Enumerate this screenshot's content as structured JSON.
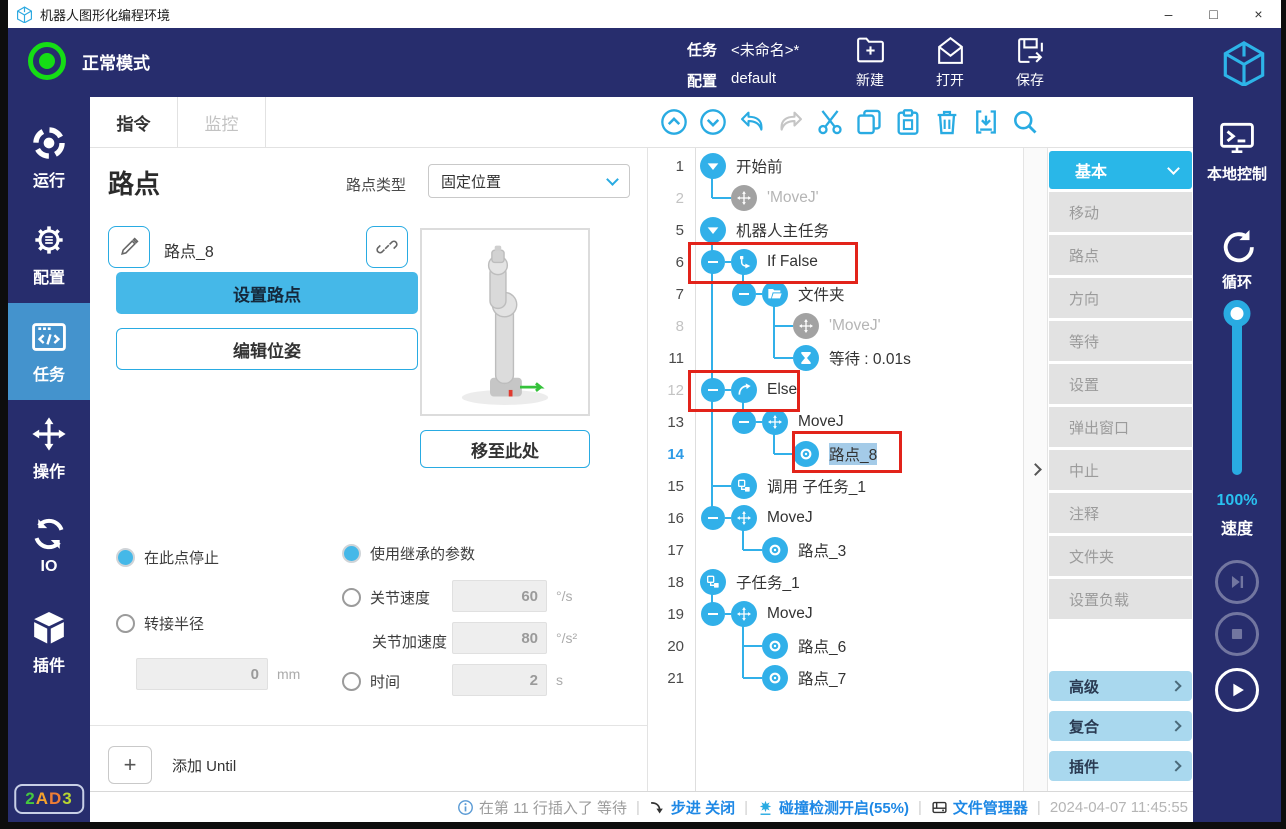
{
  "titlebar": {
    "title": "机器人图形化编程环境",
    "min": "–",
    "max": "□",
    "close": "×"
  },
  "header": {
    "mode_label": "正常模式",
    "task_label": "任务",
    "task_value": "<未命名>*",
    "config_label": "配置",
    "config_value": "default",
    "actions": [
      {
        "label": "新建"
      },
      {
        "label": "打开"
      },
      {
        "label": "保存"
      }
    ]
  },
  "left_nav": {
    "items": [
      {
        "label": "运行"
      },
      {
        "label": "配置"
      },
      {
        "label": "任务"
      },
      {
        "label": "操作"
      },
      {
        "label": "IO"
      },
      {
        "label": "插件"
      }
    ],
    "active_index": 2,
    "badge": {
      "chars": [
        {
          "ch": "2",
          "color": "#45c93f"
        },
        {
          "ch": "A",
          "color": "#f5a32c"
        },
        {
          "ch": "D",
          "color": "#ef7d35"
        },
        {
          "ch": "3",
          "color": "#b8d431"
        }
      ]
    }
  },
  "tabs": [
    {
      "label": "指令"
    },
    {
      "label": "监控"
    }
  ],
  "toolbar": {
    "icons": [
      "collapse-all",
      "expand-all",
      "undo",
      "redo",
      "cut",
      "copy",
      "paste",
      "delete",
      "insert",
      "search"
    ]
  },
  "waypoint": {
    "title": "路点",
    "type_label": "路点类型",
    "type_value": "固定位置",
    "name": "路点_8",
    "set_btn": "设置路点",
    "edit_btn": "编辑位姿",
    "move_btn": "移至此处",
    "stop_label": "在此点停止",
    "blend_label": "转接半径",
    "blend_value": "0",
    "blend_unit": "mm",
    "inherit_label": "使用继承的参数",
    "speed_label": "关节速度",
    "speed_value": "60",
    "speed_unit": "°/s",
    "accel_label": "关节加速度",
    "accel_value": "80",
    "accel_unit": "°/s²",
    "time_label": "时间",
    "time_value": "2",
    "time_unit": "s",
    "add_until": "添加 Until"
  },
  "tree": {
    "rows": [
      {
        "num": "1",
        "label": "开始前",
        "icon": "expand"
      },
      {
        "num": "2",
        "label": "'MoveJ'",
        "icon": "move"
      },
      {
        "num": "5",
        "label": "机器人主任务",
        "icon": "expand"
      },
      {
        "num": "6",
        "label": "If False",
        "icon": "if"
      },
      {
        "num": "7",
        "label": "文件夹",
        "icon": "folder"
      },
      {
        "num": "8",
        "label": "'MoveJ'",
        "icon": "move"
      },
      {
        "num": "11",
        "label": "等待 : 0.01s",
        "icon": "wait"
      },
      {
        "num": "12",
        "label": "Else",
        "icon": "else"
      },
      {
        "num": "13",
        "label": "MoveJ",
        "icon": "move"
      },
      {
        "num": "14",
        "label": "路点_8",
        "icon": "waypoint"
      },
      {
        "num": "15",
        "label": "调用 子任务_1",
        "icon": "subtask"
      },
      {
        "num": "16",
        "label": "MoveJ",
        "icon": "move"
      },
      {
        "num": "17",
        "label": "路点_3",
        "icon": "waypoint"
      },
      {
        "num": "18",
        "label": "子任务_1",
        "icon": "subtask"
      },
      {
        "num": "19",
        "label": "MoveJ",
        "icon": "move"
      },
      {
        "num": "20",
        "label": "路点_6",
        "icon": "waypoint"
      },
      {
        "num": "21",
        "label": "路点_7",
        "icon": "waypoint"
      }
    ]
  },
  "palette": {
    "basic": "基本",
    "items": [
      "移动",
      "路点",
      "方向",
      "等待",
      "设置",
      "弹出窗口",
      "中止",
      "注释",
      "文件夹",
      "设置负载"
    ],
    "groups": [
      "高级",
      "复合",
      "插件"
    ]
  },
  "rightbar": {
    "local": "本地控制",
    "loop": "循环",
    "speed_pct": "100%",
    "speed": "速度"
  },
  "statusbar": {
    "message": "在第 11 行插入了 等待",
    "step": "步进 关闭",
    "collision": "碰撞检测开启(55%)",
    "files": "文件管理器",
    "time": "2024-04-07 11:45:55"
  },
  "colors": {
    "accent": "#29abe2",
    "navy": "#272d6d",
    "active_nav": "#4493cd",
    "status_green": "#15dd15",
    "annotation_red": "#e2231a"
  }
}
